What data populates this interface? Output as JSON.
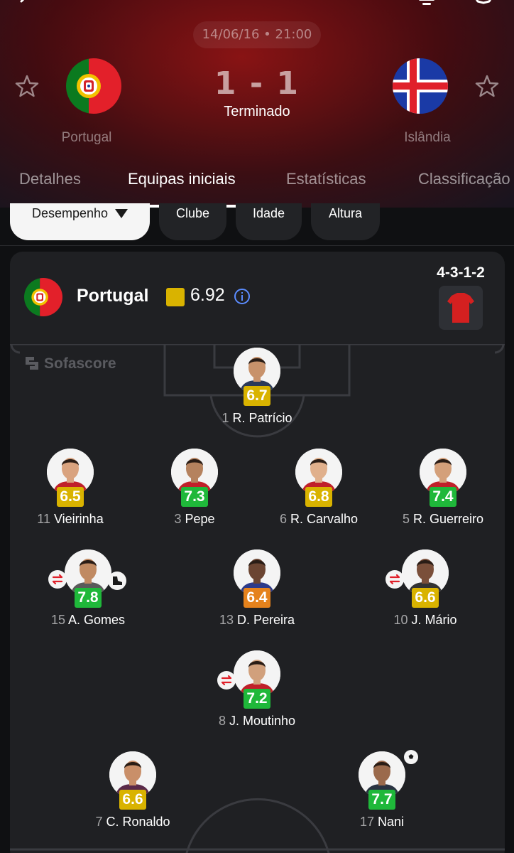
{
  "match": {
    "datetime": "14/06/16 • 21:00",
    "score": "1 - 1",
    "status": "Terminado",
    "home_team": "Portugal",
    "away_team": "Islândia"
  },
  "tabs": [
    "Detalhes",
    "Equipas iniciais",
    "Estatísticas",
    "Classificação"
  ],
  "filters": {
    "selected": "Desempenho",
    "others": [
      "Clube",
      "Idade",
      "Altura"
    ]
  },
  "lineup": {
    "team": "Portugal",
    "team_rating": "6.92",
    "formation": "4-3-1-2",
    "watermark": "Sofascore",
    "players": [
      {
        "number": "1",
        "name": "R. Patrício",
        "rating": "6.7",
        "rating_color": "#d9b300"
      },
      {
        "number": "11",
        "name": "Vieirinha",
        "rating": "6.5",
        "rating_color": "#d9b300"
      },
      {
        "number": "3",
        "name": "Pepe",
        "rating": "7.3",
        "rating_color": "#1fb83a"
      },
      {
        "number": "6",
        "name": "R. Carvalho",
        "rating": "6.8",
        "rating_color": "#d9b300"
      },
      {
        "number": "5",
        "name": "R. Guerreiro",
        "rating": "7.4",
        "rating_color": "#1fb83a"
      },
      {
        "number": "15",
        "name": "A. Gomes",
        "rating": "7.8",
        "rating_color": "#1fb83a"
      },
      {
        "number": "13",
        "name": "D. Pereira",
        "rating": "6.4",
        "rating_color": "#e5821c"
      },
      {
        "number": "10",
        "name": "J. Mário",
        "rating": "6.6",
        "rating_color": "#d9b300"
      },
      {
        "number": "8",
        "name": "J. Moutinho",
        "rating": "7.2",
        "rating_color": "#1fb83a"
      },
      {
        "number": "7",
        "name": "C. Ronaldo",
        "rating": "6.6",
        "rating_color": "#d9b300"
      },
      {
        "number": "17",
        "name": "Nani",
        "rating": "7.7",
        "rating_color": "#1fb83a"
      }
    ]
  },
  "colors": {
    "rating_yellow": "#d9b300",
    "rating_green": "#1fb83a",
    "rating_orange": "#e5821c",
    "accent_underline": "#ffffff"
  },
  "icons": [
    "back-arrow-icon",
    "filter-icon",
    "favorite-star-icon",
    "info-icon",
    "substitution-icon",
    "boot-icon",
    "goal-ball-icon",
    "jersey-icon"
  ]
}
